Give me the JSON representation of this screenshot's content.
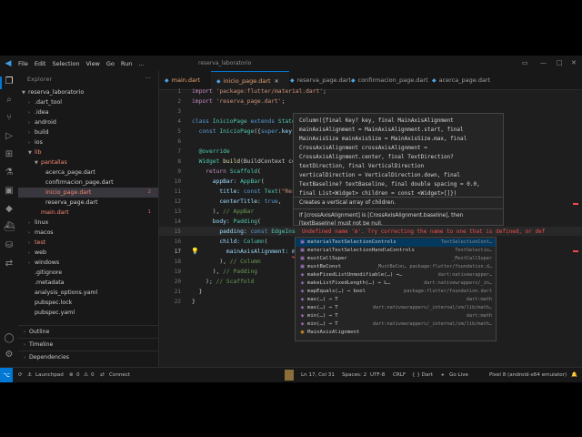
{
  "menubar": {
    "items": [
      "File",
      "Edit",
      "Selection",
      "View",
      "Go",
      "Run"
    ],
    "more": "…",
    "window_title": "reserva_laboratorio"
  },
  "explorer": {
    "title": "Explorer",
    "root": "reserva_laboratorio",
    "items": [
      {
        "label": ".dart_tool",
        "type": "folder"
      },
      {
        "label": ".idea",
        "type": "folder"
      },
      {
        "label": "android",
        "type": "folder"
      },
      {
        "label": "build",
        "type": "folder"
      },
      {
        "label": "ios",
        "type": "folder"
      },
      {
        "label": "lib",
        "type": "folder",
        "open": true,
        "error": true
      },
      {
        "label": "pantallas",
        "type": "folder",
        "open": true,
        "error": true
      },
      {
        "label": "acerca_page.dart",
        "type": "file"
      },
      {
        "label": "confirmacion_page.dart",
        "type": "file"
      },
      {
        "label": "inicio_page.dart",
        "type": "file",
        "selected": true,
        "error": true,
        "badge": "2"
      },
      {
        "label": "reserva_page.dart",
        "type": "file"
      },
      {
        "label": "main.dart",
        "type": "file",
        "error": true,
        "badge": "1"
      },
      {
        "label": "linux",
        "type": "folder"
      },
      {
        "label": "macos",
        "type": "folder"
      },
      {
        "label": "test",
        "type": "folder",
        "error": true
      },
      {
        "label": "web",
        "type": "folder"
      },
      {
        "label": "windows",
        "type": "folder"
      },
      {
        "label": ".gitignore",
        "type": "file"
      },
      {
        "label": ".metadata",
        "type": "file"
      },
      {
        "label": "analysis_options.yaml",
        "type": "file"
      },
      {
        "label": "pubspec.lock",
        "type": "file"
      },
      {
        "label": "pubspec.yaml",
        "type": "file"
      }
    ],
    "sections": [
      "Outline",
      "Timeline",
      "Dependencies"
    ]
  },
  "tabs": [
    {
      "label": "main.dart",
      "active": false
    },
    {
      "label": "inicio_page.dart",
      "active": true
    },
    {
      "label": "reserva_page.dart",
      "active": false
    },
    {
      "label": "confirmacion_page.dart",
      "active": false
    },
    {
      "label": "acerca_page.dart",
      "active": false
    }
  ],
  "editor": {
    "line_numbers": [
      "1",
      "2",
      "3",
      "4",
      "5",
      "6",
      "7",
      "8",
      "9",
      "10",
      "11",
      "12",
      "13",
      "14",
      "15",
      "16",
      "17",
      "18",
      "19",
      "20",
      "21",
      "22"
    ],
    "current_line": "17",
    "code": {
      "l1a": "import ",
      "l1b": "'package:flutter/material.dart'",
      "l1c": ";",
      "l2a": "import ",
      "l2b": "'reserva_page.dart'",
      "l2c": ";",
      "l4a": "class ",
      "l4b": "InicioPage ",
      "l4c": "extends ",
      "l4d": "Statel",
      "l5a": "  const ",
      "l5b": "InicioPage",
      "l5c": "({",
      "l5d": "super",
      "l5e": ".key",
      "l7": "  @override",
      "l8a": "  Widget ",
      "l8b": "build",
      "l8c": "(BuildContext co",
      "l9a": "    return ",
      "l9b": "Scaffold",
      "l9c": "(",
      "l10a": "      appBar: ",
      "l10b": "AppBar",
      "l10c": "(",
      "l11a": "        title: ",
      "l11b": "const ",
      "l11c": "Text",
      "l11d": "(\"Res",
      "l12a": "        centerTitle: ",
      "l12b": "true",
      "l12c": ",",
      "l13a": "      ), ",
      "l13b": "// AppBar",
      "l14a": "      body: ",
      "l14b": "Padding",
      "l14c": "(",
      "l15a": "        padding: ",
      "l15b": "const ",
      "l15c": "EdgeIns",
      "l16a": "        child: ",
      "l16b": "Column",
      "l16c": "(",
      "l17a": "          mainAxisAlignment: ",
      "l17b": "m",
      "l18a": "        ), ",
      "l18b": "// Column",
      "l19a": "      ), ",
      "l19b": "// Padding",
      "l20a": "    ); ",
      "l20b": "// Scaffold",
      "l21": "  }",
      "l22": "}"
    }
  },
  "hover": {
    "signature": "Column({final Key? key, final MainAxisAlignment\nmainAxisAlignment = MainAxisAlignment.start, final\nMainAxisSize mainAxisSize = MainAxisSize.max, final\nCrossAxisAlignment crossAxisAlignment =\nCrossAxisAlignment.center, final TextDirection?\ntextDirection, final VerticalDirection\nverticalDirection = VerticalDirection.down, final\nTextBaseline? textBaseline, final double spacing = 0.0,\nfinal List<Widget> children = const <Widget>[]})",
    "doc1": "Creates a vertical array of children.",
    "doc2": "If [crossAxisAlignment] is [CrossAxisAlignment.baseline], then [textBaseline] must not be null."
  },
  "diagnostic": "Undefined name 'm'. Try correcting the name to one that is defined, or def",
  "suggestions": [
    {
      "label": "materialTextSelectionControls",
      "detail": "TextSelectionCont…",
      "icon": "variable-icon"
    },
    {
      "label": "materialTextSelectionHandleControls",
      "detail": "TextSelectio…",
      "icon": "variable-icon"
    },
    {
      "label": "mustCallSuper",
      "detail": "_MustCallSuper",
      "icon": "variable-icon"
    },
    {
      "label": "mustBeConst",
      "detail": "_MustBeCon… package:flutter/foundation.d…",
      "icon": "variable-icon"
    },
    {
      "label": "makeFixedListUnmodifiable(…) →…",
      "detail": "dart:nativewrapper…",
      "icon": "method-icon"
    },
    {
      "label": "makeListFixedLength(…) → L…",
      "detail": "dart:nativewrappers/_in…",
      "icon": "method-icon"
    },
    {
      "label": "mapEquals(…) → bool",
      "detail": "package:flutter/foundation.dart",
      "icon": "method-icon"
    },
    {
      "label": "max(…) → T",
      "detail": "dart:math",
      "icon": "method-icon"
    },
    {
      "label": "max(…) → T",
      "detail": "dart:nativewrappers/_internal/vm/lib/math…",
      "icon": "method-icon"
    },
    {
      "label": "min(…) → T",
      "detail": "dart:math",
      "icon": "method-icon"
    },
    {
      "label": "min(…) → T",
      "detail": "dart:nativewrappers/_internal/vm/lib/math…",
      "icon": "method-icon"
    },
    {
      "label": "MainAxisAlignment",
      "detail": "",
      "icon": "class-icon"
    }
  ],
  "statusbar": {
    "launchpad": "Launchpad",
    "errors": "0",
    "warnings": "0",
    "connect": "Connect",
    "position": "Ln 17, Col 31",
    "spaces": "Spaces: 2",
    "encoding": "UTF-8",
    "eol": "CRLF",
    "language": "{ } Dart",
    "golive": "Go Live",
    "device": "Pixel 8 (android-x64 emulator)"
  }
}
